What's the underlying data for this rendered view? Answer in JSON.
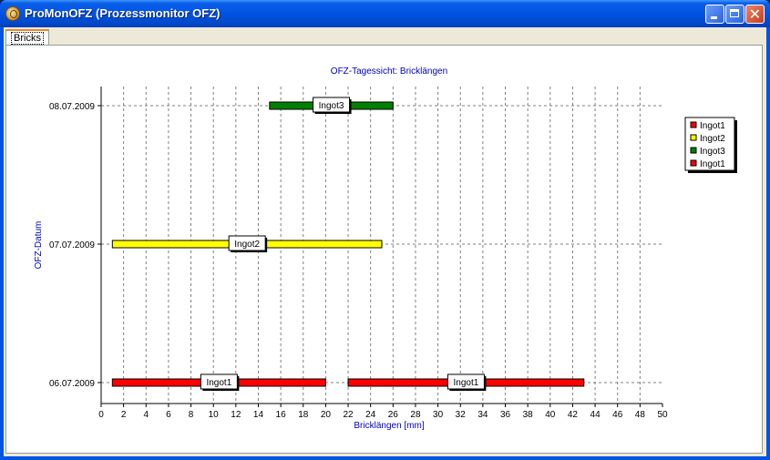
{
  "window": {
    "title": "ProMonOFZ (Prozessmonitor OFZ)",
    "icon": "app-icon",
    "controls": [
      "minimize-icon",
      "maximize-icon",
      "close-icon"
    ]
  },
  "tabs": [
    {
      "label": "Bricks",
      "active": true
    }
  ],
  "colors": {
    "titlebar": "#0054e3",
    "ingot1": "#ff0000",
    "ingot2": "#ffff00",
    "ingot3": "#008000",
    "title_text": "#0000c0"
  },
  "chart_data": {
    "type": "gantt",
    "title": "OFZ-Tagessicht: Bricklängen",
    "xlabel": "Bricklängen [mm]",
    "ylabel": "OFZ-Datum",
    "xlim": [
      0,
      50
    ],
    "xticks": [
      0,
      2,
      4,
      6,
      8,
      10,
      12,
      14,
      16,
      18,
      20,
      22,
      24,
      26,
      28,
      30,
      32,
      34,
      36,
      38,
      40,
      42,
      44,
      46,
      48,
      50
    ],
    "categories": [
      "06.07.2009",
      "07.07.2009",
      "08.07.2009"
    ],
    "grid": true,
    "legend_position": "right",
    "series": [
      {
        "name": "Ingot1",
        "color": "#ff0000",
        "category": "06.07.2009",
        "start": 1,
        "end": 20,
        "label": "Ingot1"
      },
      {
        "name": "Ingot2",
        "color": "#ffff00",
        "category": "07.07.2009",
        "start": 1,
        "end": 25,
        "label": "Ingot2"
      },
      {
        "name": "Ingot3",
        "color": "#008000",
        "category": "08.07.2009",
        "start": 15,
        "end": 26,
        "label": "Ingot3"
      },
      {
        "name": "Ingot1",
        "color": "#ff0000",
        "category": "06.07.2009",
        "start": 22,
        "end": 43,
        "label": "Ingot1"
      }
    ]
  }
}
